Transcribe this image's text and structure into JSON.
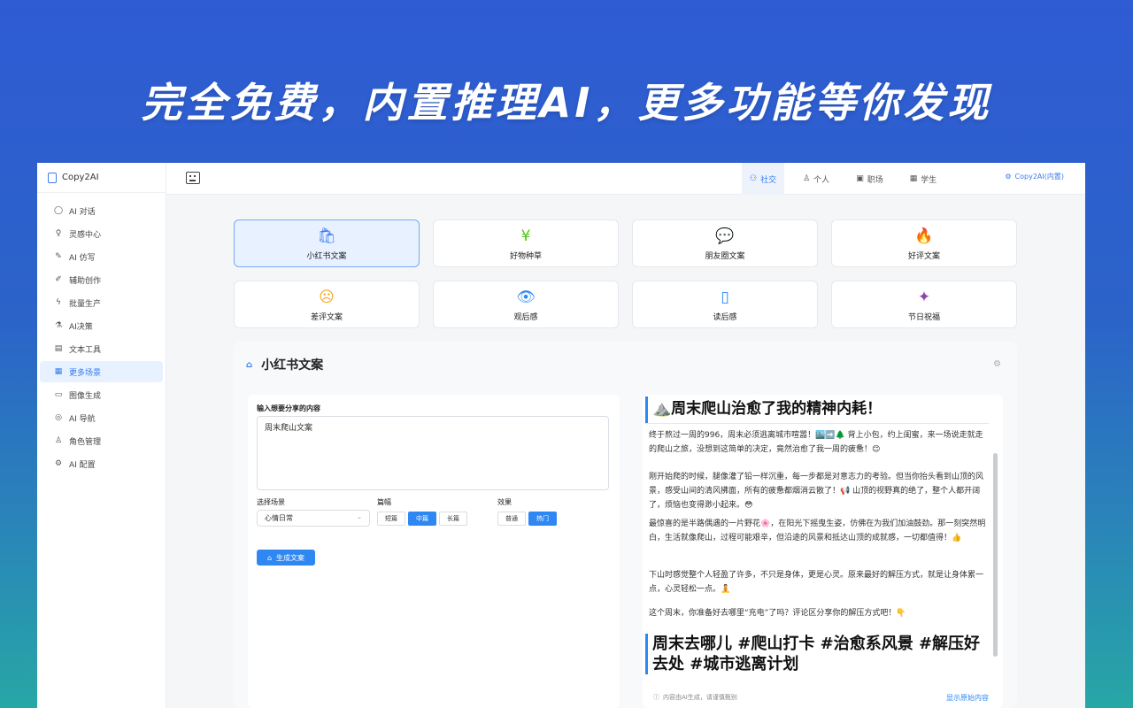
{
  "banner": "完全免费，内置推理AI，更多功能等你发现",
  "brand": "Copy2AI",
  "sidebar": {
    "items": [
      {
        "label": "AI 对话",
        "icon": "chat-icon"
      },
      {
        "label": "灵感中心",
        "icon": "bulb-icon"
      },
      {
        "label": "AI 仿写",
        "icon": "pen-icon"
      },
      {
        "label": "辅助创作",
        "icon": "brush-icon"
      },
      {
        "label": "批量生产",
        "icon": "bolt-icon"
      },
      {
        "label": "AI决策",
        "icon": "flask-icon"
      },
      {
        "label": "文本工具",
        "icon": "file-icon"
      },
      {
        "label": "更多场景",
        "icon": "grid-icon"
      },
      {
        "label": "图像生成",
        "icon": "image-icon"
      },
      {
        "label": "AI 导航",
        "icon": "compass-icon"
      },
      {
        "label": "角色管理",
        "icon": "user-gear-icon"
      },
      {
        "label": "AI 配置",
        "icon": "settings-icon"
      }
    ],
    "active_index": 7
  },
  "topbar": {
    "tabs": [
      {
        "label": "社交",
        "icon": "users-icon"
      },
      {
        "label": "个人",
        "icon": "user-icon"
      },
      {
        "label": "职场",
        "icon": "briefcase-icon"
      },
      {
        "label": "学生",
        "icon": "grid-icon"
      }
    ],
    "active_tab": 0,
    "user": "Copy2AI(内置)"
  },
  "scene_cards": [
    {
      "label": "小红书文案",
      "icon": "bag-icon",
      "color": "#3a7bf0"
    },
    {
      "label": "好物种草",
      "icon": "calendar-yen-icon",
      "color": "#52c41a"
    },
    {
      "label": "朋友圈文案",
      "icon": "chat-bubble-icon",
      "color": "#2f88f2"
    },
    {
      "label": "好评文案",
      "icon": "fire-icon",
      "color": "#f5642d"
    },
    {
      "label": "差评文案",
      "icon": "sad-face-icon",
      "color": "#f5a623"
    },
    {
      "label": "观后感",
      "icon": "eye-icon",
      "color": "#2f88f2"
    },
    {
      "label": "读后感",
      "icon": "book-icon",
      "color": "#2f88f2"
    },
    {
      "label": "节日祝福",
      "icon": "party-icon",
      "color": "#8e44ad"
    }
  ],
  "panel": {
    "title": "小红书文案",
    "form": {
      "input_label": "输入想要分享的内容",
      "input_value": "周末爬山文案",
      "scene_label": "选择场景",
      "scene_value": "心情日常",
      "length_label": "篇幅",
      "length_options": [
        "短篇",
        "中篇",
        "长篇"
      ],
      "length_selected": 1,
      "effect_label": "效果",
      "effect_options": [
        "普通",
        "热门"
      ],
      "effect_selected": 1,
      "generate_label": "生成文案"
    },
    "output": {
      "heading": "⛰️周末爬山治愈了我的精神内耗！",
      "paragraphs": [
        "终于熬过一周的996，周末必须逃离城市喧嚣！🏙️➡️🌲 背上小包，约上闺蜜，来一场说走就走的爬山之旅，没想到这简单的决定，竟然治愈了我一周的疲惫！😊",
        "刚开始爬的时候，腿像灌了铅一样沉重，每一步都是对意志力的考验。但当你抬头看到山顶的风景，感受山间的清风拂面，所有的疲惫都烟消云散了！📢 山顶的视野真的绝了，整个人都开阔了，烦恼也变得渺小起来。😳",
        "最惊喜的是半路偶遇的一片野花🌸，在阳光下摇曳生姿，仿佛在为我们加油鼓劲。那一刻突然明白，生活就像爬山，过程可能艰辛，但沿途的风景和抵达山顶的成就感，一切都值得！👍",
        "下山时感觉整个人轻盈了许多，不只是身体，更是心灵。原来最好的解压方式，就是让身体累一点，心灵轻松一点。🧘",
        "这个周末，你准备好去哪里“充电”了吗？评论区分享你的解压方式吧！👇"
      ],
      "hashtags": "周末去哪儿 #爬山打卡 #治愈系风景 #解压好去处 #城市逃离计划",
      "footer_note": "内容由AI生成，请谨慎甄别",
      "footer_link": "显示原始内容"
    }
  }
}
